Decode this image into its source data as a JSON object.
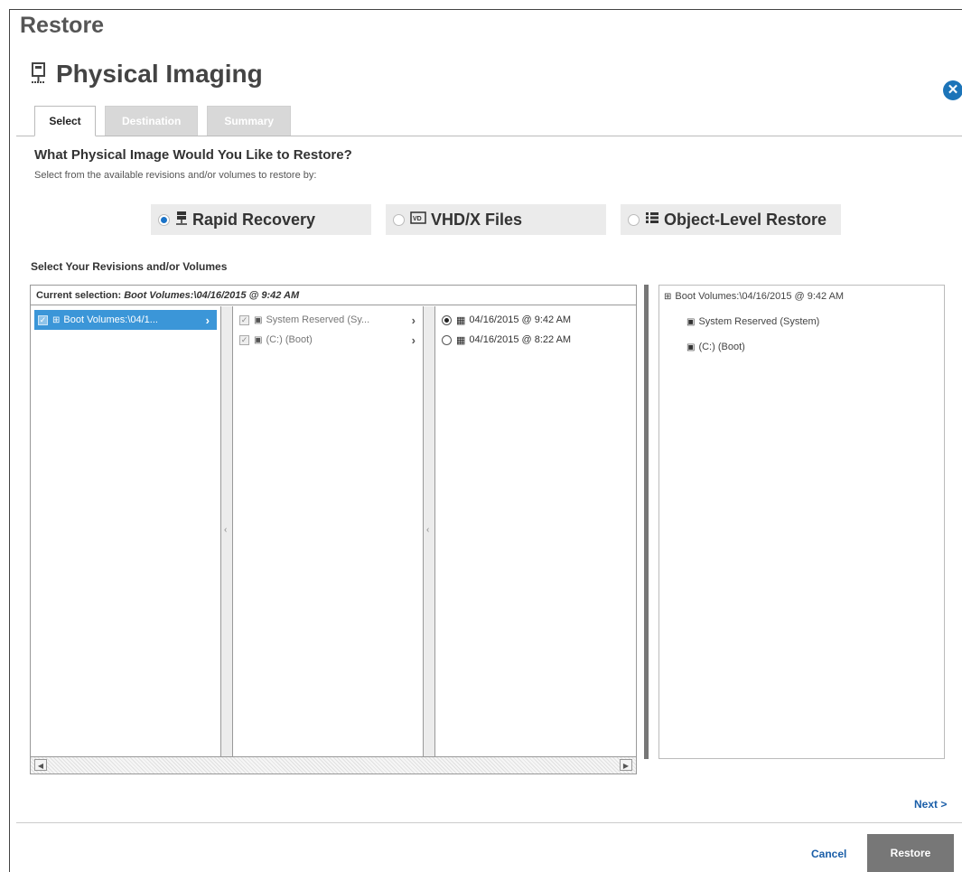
{
  "window": {
    "heading": "Restore"
  },
  "dialog": {
    "title": "Physical Imaging",
    "close_glyph": "✕"
  },
  "tabs": [
    {
      "label": "Select",
      "active": true
    },
    {
      "label": "Destination",
      "active": false
    },
    {
      "label": "Summary",
      "active": false
    }
  ],
  "question": {
    "title": "What Physical Image Would You Like to Restore?",
    "subtitle": "Select from the available revisions and/or volumes to restore by:"
  },
  "restore_options": [
    {
      "label": "Rapid Recovery",
      "selected": true,
      "icon": "server-icon"
    },
    {
      "label": "VHD/X Files",
      "selected": false,
      "icon": "vhd-icon"
    },
    {
      "label": "Object-Level Restore",
      "selected": false,
      "icon": "list-icon"
    }
  ],
  "section_label": "Select Your Revisions and/or Volumes",
  "browser": {
    "current_selection_label": "Current selection:",
    "current_selection_value": "Boot Volumes:\\04/16/2015 @ 9:42 AM",
    "column1": [
      {
        "label": "Boot Volumes:\\04/1...",
        "selected": true
      }
    ],
    "column2": [
      {
        "label": "System Reserved (Sy..."
      },
      {
        "label": "(C:) (Boot)"
      }
    ],
    "column3": [
      {
        "label": "04/16/2015 @ 9:42 AM",
        "selected": true
      },
      {
        "label": "04/16/2015 @ 8:22 AM",
        "selected": false
      }
    ],
    "splitter_glyph": "‹",
    "scroll_left_glyph": "◀",
    "scroll_right_glyph": "▶"
  },
  "summary_panel": {
    "root": "Boot Volumes:\\04/16/2015 @ 9:42 AM",
    "children": [
      "System Reserved (System)",
      "(C:) (Boot)"
    ]
  },
  "footer": {
    "next": "Next >",
    "cancel": "Cancel",
    "restore": "Restore"
  },
  "colors": {
    "accent": "#1a73c8",
    "selection": "#3b96d8",
    "primary_button": "#777777",
    "link": "#1a5ea8"
  }
}
